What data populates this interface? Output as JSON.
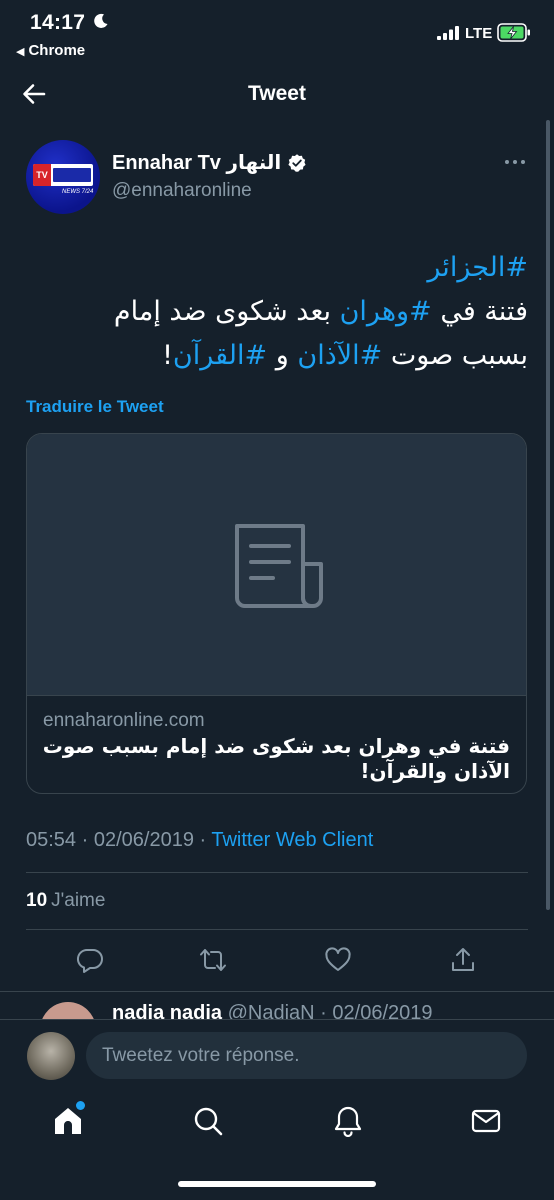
{
  "status_bar": {
    "time": "14:17",
    "back_app": "Chrome",
    "network": "LTE",
    "moon_icon": "moon-icon",
    "signal_icon": "signal-icon",
    "battery_icon": "battery-charging-icon"
  },
  "header": {
    "title": "Tweet",
    "back_icon": "arrow-left-icon"
  },
  "tweet": {
    "author": {
      "display_name": "Ennahar Tv النهار",
      "handle": "@ennaharonline",
      "verified": true,
      "avatar_badge": "TV",
      "avatar_sub": "NEWS 7/24"
    },
    "text_line1_hashtag": "#الجزائر",
    "text_line2_a": "فتنة في ",
    "text_line2_hashtag": "#وهران",
    "text_line2_b": " بعد شكوى ضد إمام",
    "text_line3_a": "بسبب صوت ",
    "text_line3_hashtag1": "#الآذان",
    "text_line3_b": " و ",
    "text_line3_hashtag2": "#القرآن",
    "text_line3_c": "!",
    "translate_label": "Traduire le Tweet",
    "card": {
      "domain": "ennaharonline.com",
      "title_line1": "فتنة في وهران بعد شكوى ضد إمام بسبب صوت",
      "title_line2": "الآذان والقرآن!",
      "media_icon": "document-icon"
    },
    "time": "05:54",
    "date": "02/06/2019",
    "separator": " · ",
    "client": "Twitter Web Client",
    "likes_count": "10",
    "likes_label": "J'aime"
  },
  "actions": [
    {
      "name": "reply",
      "icon": "reply-icon"
    },
    {
      "name": "retweet",
      "icon": "retweet-icon"
    },
    {
      "name": "like",
      "icon": "heart-icon"
    },
    {
      "name": "share",
      "icon": "share-icon"
    }
  ],
  "reply_preview": {
    "name": "nadia nadia",
    "handle": "@NadiaN",
    "sep": " · ",
    "date": "02/06/2019"
  },
  "composer": {
    "placeholder": "Tweetez votre réponse."
  },
  "tabbar": {
    "items": [
      "home-icon",
      "search-icon",
      "notifications-icon",
      "messages-icon"
    ],
    "home_has_dot": true
  },
  "colors": {
    "background": "#15202b",
    "accent": "#1da1f2",
    "secondary_text": "#8899a6",
    "border": "#38444d"
  }
}
